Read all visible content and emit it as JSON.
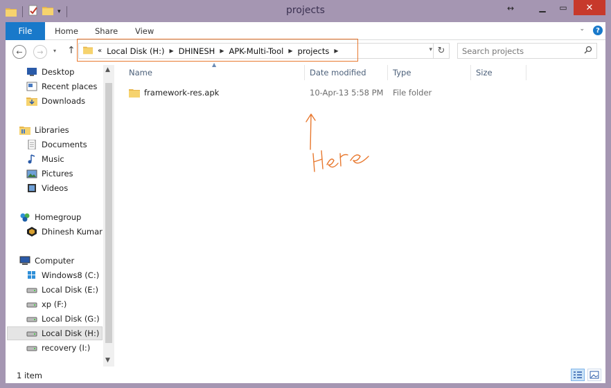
{
  "window": {
    "title": "projects"
  },
  "ribbon": {
    "tabs": [
      "File",
      "Home",
      "Share",
      "View"
    ]
  },
  "address": {
    "overflow": "«",
    "crumbs": [
      "Local Disk (H:)",
      "DHINESH",
      "APK-Multi-Tool",
      "projects"
    ]
  },
  "search": {
    "placeholder": "Search projects"
  },
  "sidebar": {
    "favorites": [
      "Desktop",
      "Recent places",
      "Downloads"
    ],
    "libraries_label": "Libraries",
    "libraries": [
      "Documents",
      "Music",
      "Pictures",
      "Videos"
    ],
    "homegroup_label": "Homegroup",
    "homegroup_user": "Dhinesh Kumar",
    "computer_label": "Computer",
    "drives": [
      "Windows8 (C:)",
      "Local Disk (E:)",
      "xp (F:)",
      "Local Disk (G:)",
      "Local Disk (H:)",
      "recovery (I:)"
    ]
  },
  "columns": {
    "name": "Name",
    "date": "Date modified",
    "type": "Type",
    "size": "Size"
  },
  "files": [
    {
      "name": "framework-res.apk",
      "date": "10-Apr-13 5:58 PM",
      "type": "File folder",
      "size": ""
    }
  ],
  "annotation": {
    "text": "Here",
    "color": "#e8782e"
  },
  "status": {
    "item_count": "1 item"
  },
  "colors": {
    "accent": "#1979ca",
    "highlight": "#e8782e",
    "close": "#c7392b"
  }
}
